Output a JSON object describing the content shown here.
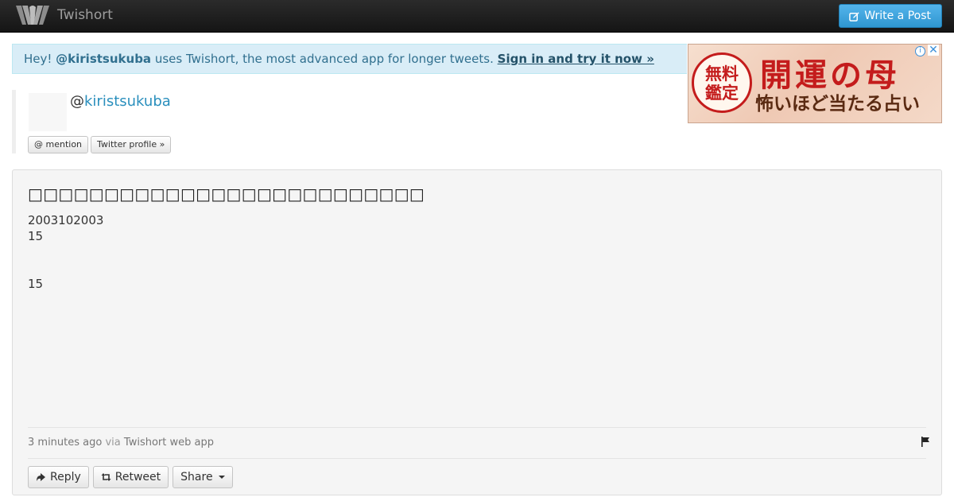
{
  "navbar": {
    "brand": "Twishort",
    "logo_icon": "twishort-logo-icon",
    "write_button": "Write a Post",
    "write_icon": "edit-icon"
  },
  "alert": {
    "prefix": "Hey! ",
    "user": "@kiristsukuba",
    "middle": " uses Twishort, the most advanced app for longer tweets. ",
    "link": "Sign in and try it now »"
  },
  "ad": {
    "seal_line1": "無料",
    "seal_line2": "鑑定",
    "headline": "開運の母",
    "subline": "怖いほど当たる占い",
    "info_icon": "i",
    "close_icon": "✕"
  },
  "profile": {
    "at": "@",
    "username": "kiristsukuba",
    "mention_button": "@ mention",
    "twitter_profile_button": "Twitter profile »"
  },
  "post": {
    "title": "□□□□□□□□□□□□□□□□□□□□□□□□□□",
    "lines": [
      "2003102003",
      "15",
      "",
      "",
      "15"
    ],
    "time": "3 minutes ago",
    "via_label": "via",
    "via_app": "Twishort web app",
    "reply": "Reply",
    "retweet": "Retweet",
    "share": "Share"
  },
  "colors": {
    "navbar": "#1b1b1b",
    "primary_button": "#3aa1d9",
    "alert_bg": "#d9edf7",
    "alert_text": "#31708f",
    "link": "#2a8fbd",
    "post_bg": "#f5f5f5"
  }
}
